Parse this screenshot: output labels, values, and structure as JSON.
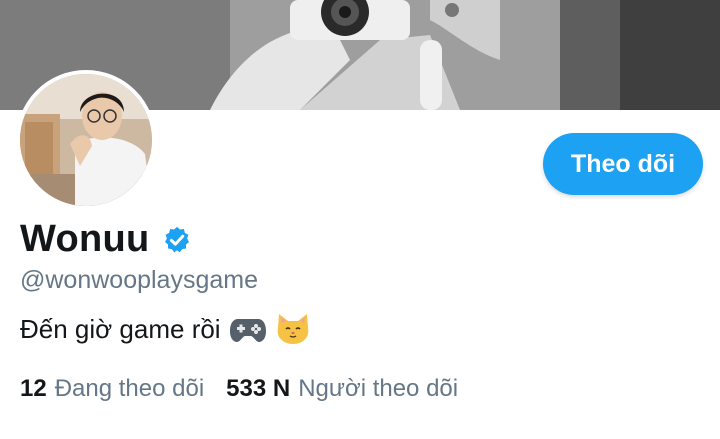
{
  "profile": {
    "display_name": "Wonuu",
    "verified_icon": "verified-badge-icon",
    "handle": "@wonwooplaysgame",
    "bio_text": "Đến giờ game rồi",
    "bio_emojis": [
      "game-controller-icon",
      "cat-face-icon"
    ],
    "follow_button_label": "Theo dõi",
    "following_count": "12",
    "following_label": "Đang theo dõi",
    "followers_count": "533 N",
    "followers_label": "Người theo dõi"
  },
  "colors": {
    "accent": "#1da1f2",
    "text_primary": "#14171a",
    "text_secondary": "#657786",
    "background": "#ffffff"
  },
  "images": {
    "banner": "banner-photo",
    "avatar": "avatar-photo"
  }
}
